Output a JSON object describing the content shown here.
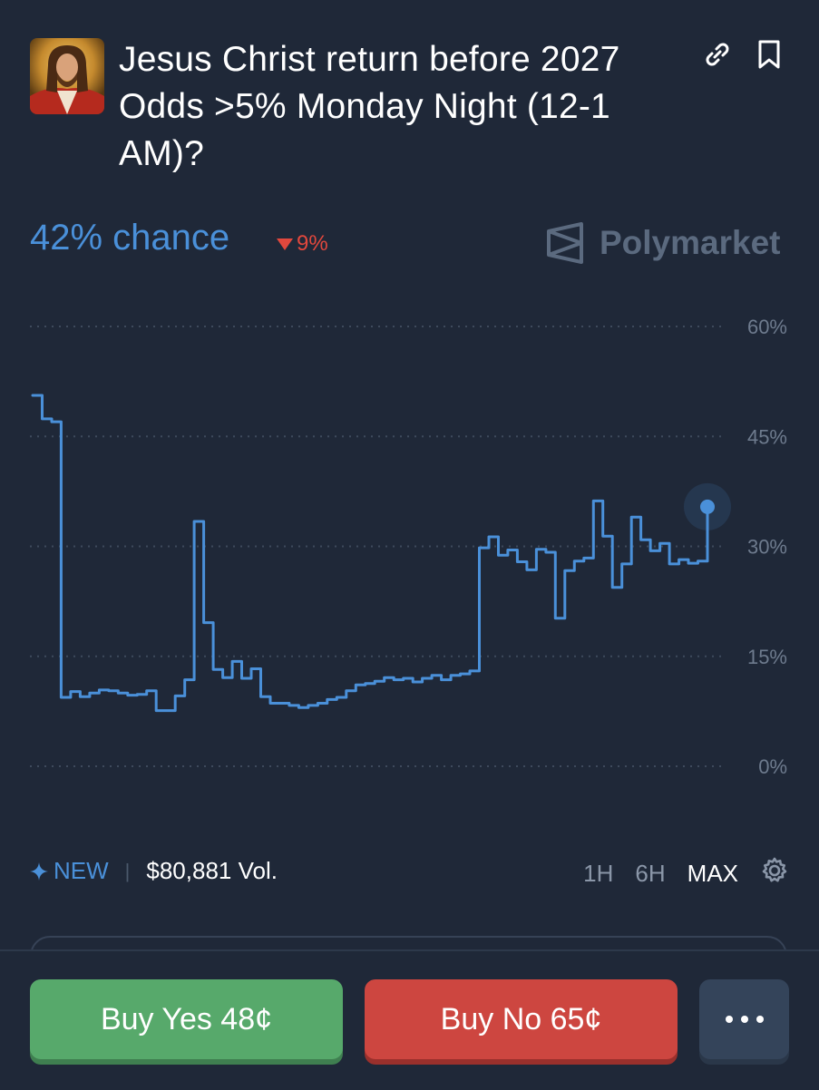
{
  "market": {
    "title": "Jesus Christ return before 2027 Odds >5% Monday Night (12-1 AM)?",
    "chance": "42% chance",
    "change": "9%",
    "brand": "Polymarket"
  },
  "icons": {
    "avatar": "jesus-portrait",
    "link": "link-icon",
    "bookmark": "bookmark-icon",
    "change": "down-triangle-icon",
    "brand": "polymarket-logo-icon",
    "new": "sparkle-icon",
    "settings": "gear-icon"
  },
  "stats": {
    "new_label": "NEW",
    "separator": "|",
    "volume": "$80,881 Vol."
  },
  "ranges": [
    "1H",
    "6H",
    "MAX"
  ],
  "buttons": {
    "yes": "Buy Yes 48¢",
    "no": "Buy No 65¢",
    "more": "more-options"
  },
  "colors": {
    "background": "#1f2838",
    "accent": "#4a90d9",
    "down": "#e2483d",
    "yes": "#57a96b",
    "no": "#cd4640"
  },
  "chart_data": {
    "type": "line",
    "y_ticks": [
      "60%",
      "45%",
      "30%",
      "15%",
      "0%"
    ],
    "ylim": [
      0,
      60
    ],
    "grid": true,
    "series": [
      {
        "values": [
          50.6,
          47.4,
          47.0,
          9.4,
          10.2,
          9.5,
          10.0,
          10.4,
          10.3,
          10.0,
          9.7,
          9.8,
          10.3,
          7.6,
          7.6,
          9.6,
          11.8,
          33.4,
          19.6,
          13.2,
          12.1,
          14.3,
          12.0,
          13.3,
          9.5,
          8.6,
          8.6,
          8.3,
          8.0,
          8.3,
          8.6,
          9.1,
          9.4,
          10.3,
          11.1,
          11.3,
          11.6,
          12.1,
          11.8,
          12.0,
          11.5,
          12.0,
          12.4,
          11.8,
          12.4,
          12.6,
          13.0,
          29.8,
          31.3,
          28.8,
          29.5,
          27.9,
          26.8,
          29.6,
          29.2,
          20.2,
          26.7,
          28.0,
          28.4,
          36.2,
          31.4,
          24.4,
          27.6,
          34.0,
          30.9,
          29.4,
          30.4,
          27.6,
          28.2,
          27.7,
          28.0,
          35.4
        ]
      }
    ],
    "last_value": 35.4
  }
}
